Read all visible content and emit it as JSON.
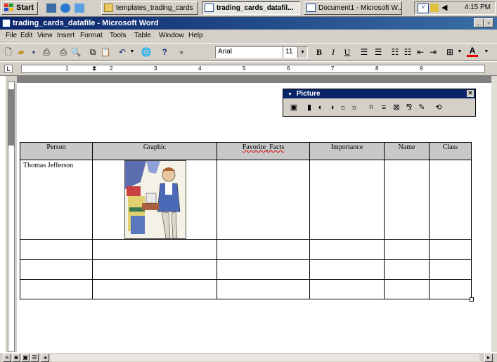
{
  "taskbar": {
    "start_label": "Start",
    "buttons": [
      {
        "label": "templates_trading_cards"
      },
      {
        "label": "trading_cards_datafil..."
      },
      {
        "label": "Document1 - Microsoft W..."
      }
    ],
    "clock": "4:15 PM"
  },
  "window": {
    "title": "trading_cards_datafile - Microsoft Word"
  },
  "menu": {
    "items": [
      "File",
      "Edit",
      "View",
      "Insert",
      "Format",
      "Tools",
      "Table",
      "Window",
      "Help"
    ]
  },
  "toolbar": {
    "font_name": "Arial",
    "font_size": "11",
    "bold": "B",
    "italic": "I",
    "underline": "U",
    "font_color_letter": "A"
  },
  "ruler": {
    "numbers": [
      "1",
      "2",
      "3",
      "4",
      "5",
      "6",
      "7",
      "8",
      "9"
    ]
  },
  "picture_toolbar": {
    "title": "Picture"
  },
  "table": {
    "headers": [
      "Person",
      "Graphic",
      "Favorite_Facts",
      "Importance",
      "Name",
      "Class"
    ],
    "rows": [
      [
        "Thomas Jefferson",
        "",
        "",
        "",
        "",
        ""
      ],
      [
        "",
        "",
        "",
        "",
        "",
        ""
      ],
      [
        "",
        "",
        "",
        "",
        "",
        ""
      ],
      [
        "",
        "",
        "",
        "",
        "",
        ""
      ]
    ]
  },
  "colors": {
    "titlebar": "#0a246a",
    "header_fill": "#c8c8c8",
    "chrome": "#d4d0c8"
  }
}
